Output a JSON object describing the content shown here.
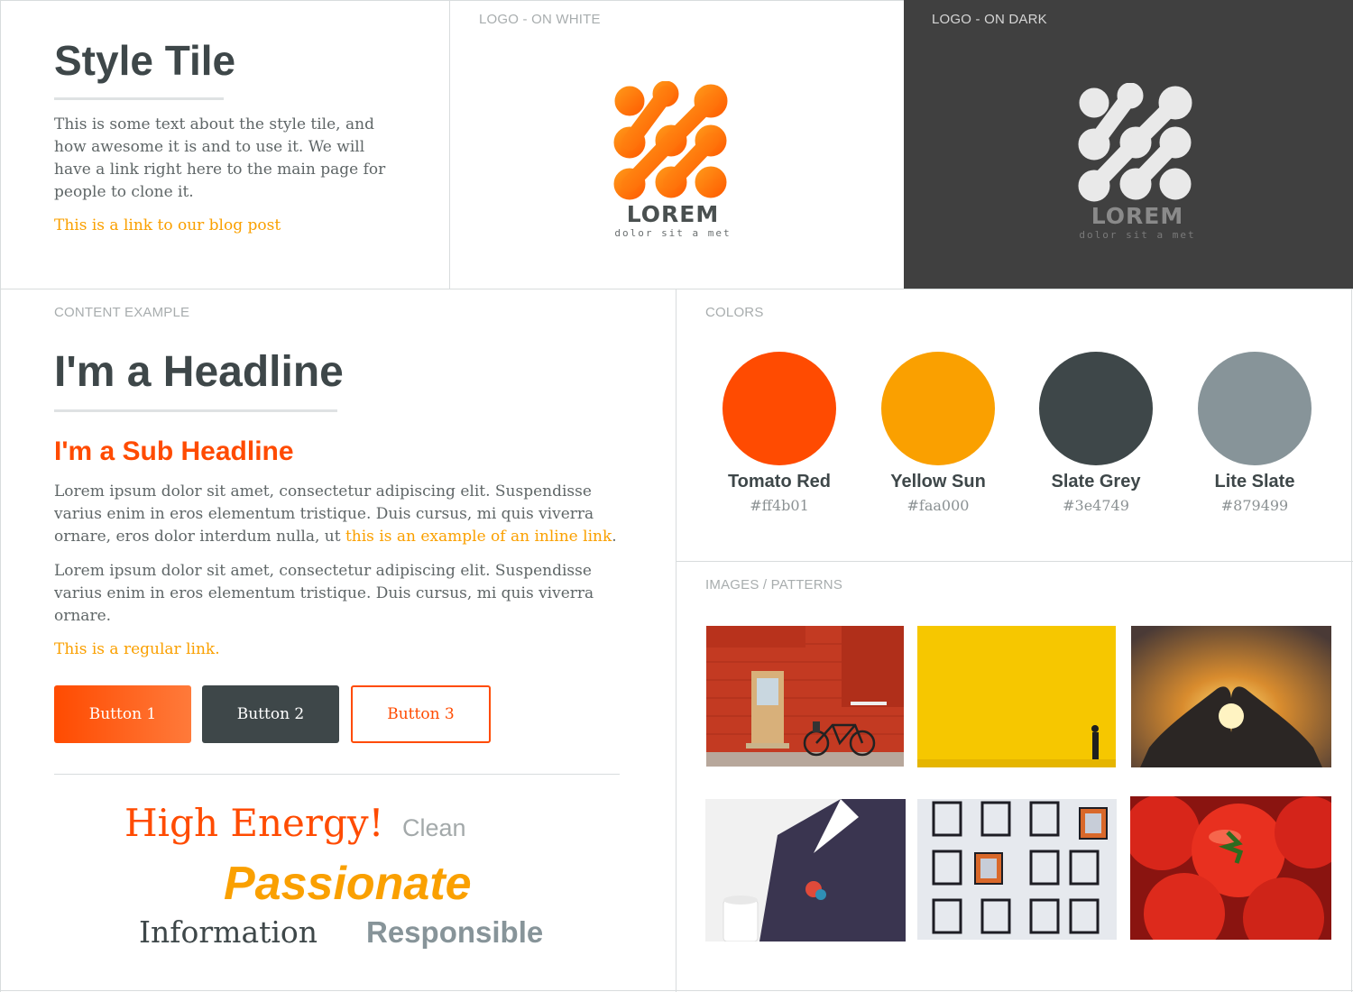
{
  "intro": {
    "title": "Style Tile",
    "description": "This is some text about the style tile, and how awesome it is and to use it. We will have a link right here to the main page for people to clone it.",
    "link": "This is a link to our blog post"
  },
  "logo_white": {
    "label": "LOGO - ON WHITE",
    "word": "LOREM",
    "tagline": "dolor sit a met"
  },
  "logo_dark": {
    "label": "LOGO - ON DARK",
    "word": "LOREM",
    "tagline": "dolor sit a met"
  },
  "content": {
    "label": "CONTENT EXAMPLE",
    "headline": "I'm a Headline",
    "subheadline": "I'm a Sub Headline",
    "para1_text": "Lorem ipsum dolor sit amet, consectetur adipiscing elit. Suspendisse varius enim in eros elementum tristique. Duis cursus, mi quis viverra ornare, eros dolor interdum nulla, ut ",
    "para1_link": "this is an example of an inline link",
    "para1_end": ".",
    "para2": "Lorem ipsum dolor sit amet, consectetur adipiscing elit. Suspendisse varius enim in eros elementum tristique. Duis cursus, mi quis viverra ornare.",
    "regular_link": "This is a regular link.",
    "buttons": [
      "Button 1",
      "Button 2",
      "Button 3"
    ],
    "words": {
      "energy": "High Energy!",
      "clean": "Clean",
      "passionate": "Passionate",
      "information": "Information",
      "responsible": "Responsible"
    }
  },
  "colors": {
    "label": "COLORS",
    "swatches": [
      {
        "name": "Tomato Red",
        "hex": "#ff4b01"
      },
      {
        "name": "Yellow Sun",
        "hex": "#faa000"
      },
      {
        "name": "Slate Grey",
        "hex": "#3e4749"
      },
      {
        "name": "Lite Slate",
        "hex": "#879499"
      }
    ]
  },
  "images": {
    "label": "IMAGES / PATTERNS"
  }
}
